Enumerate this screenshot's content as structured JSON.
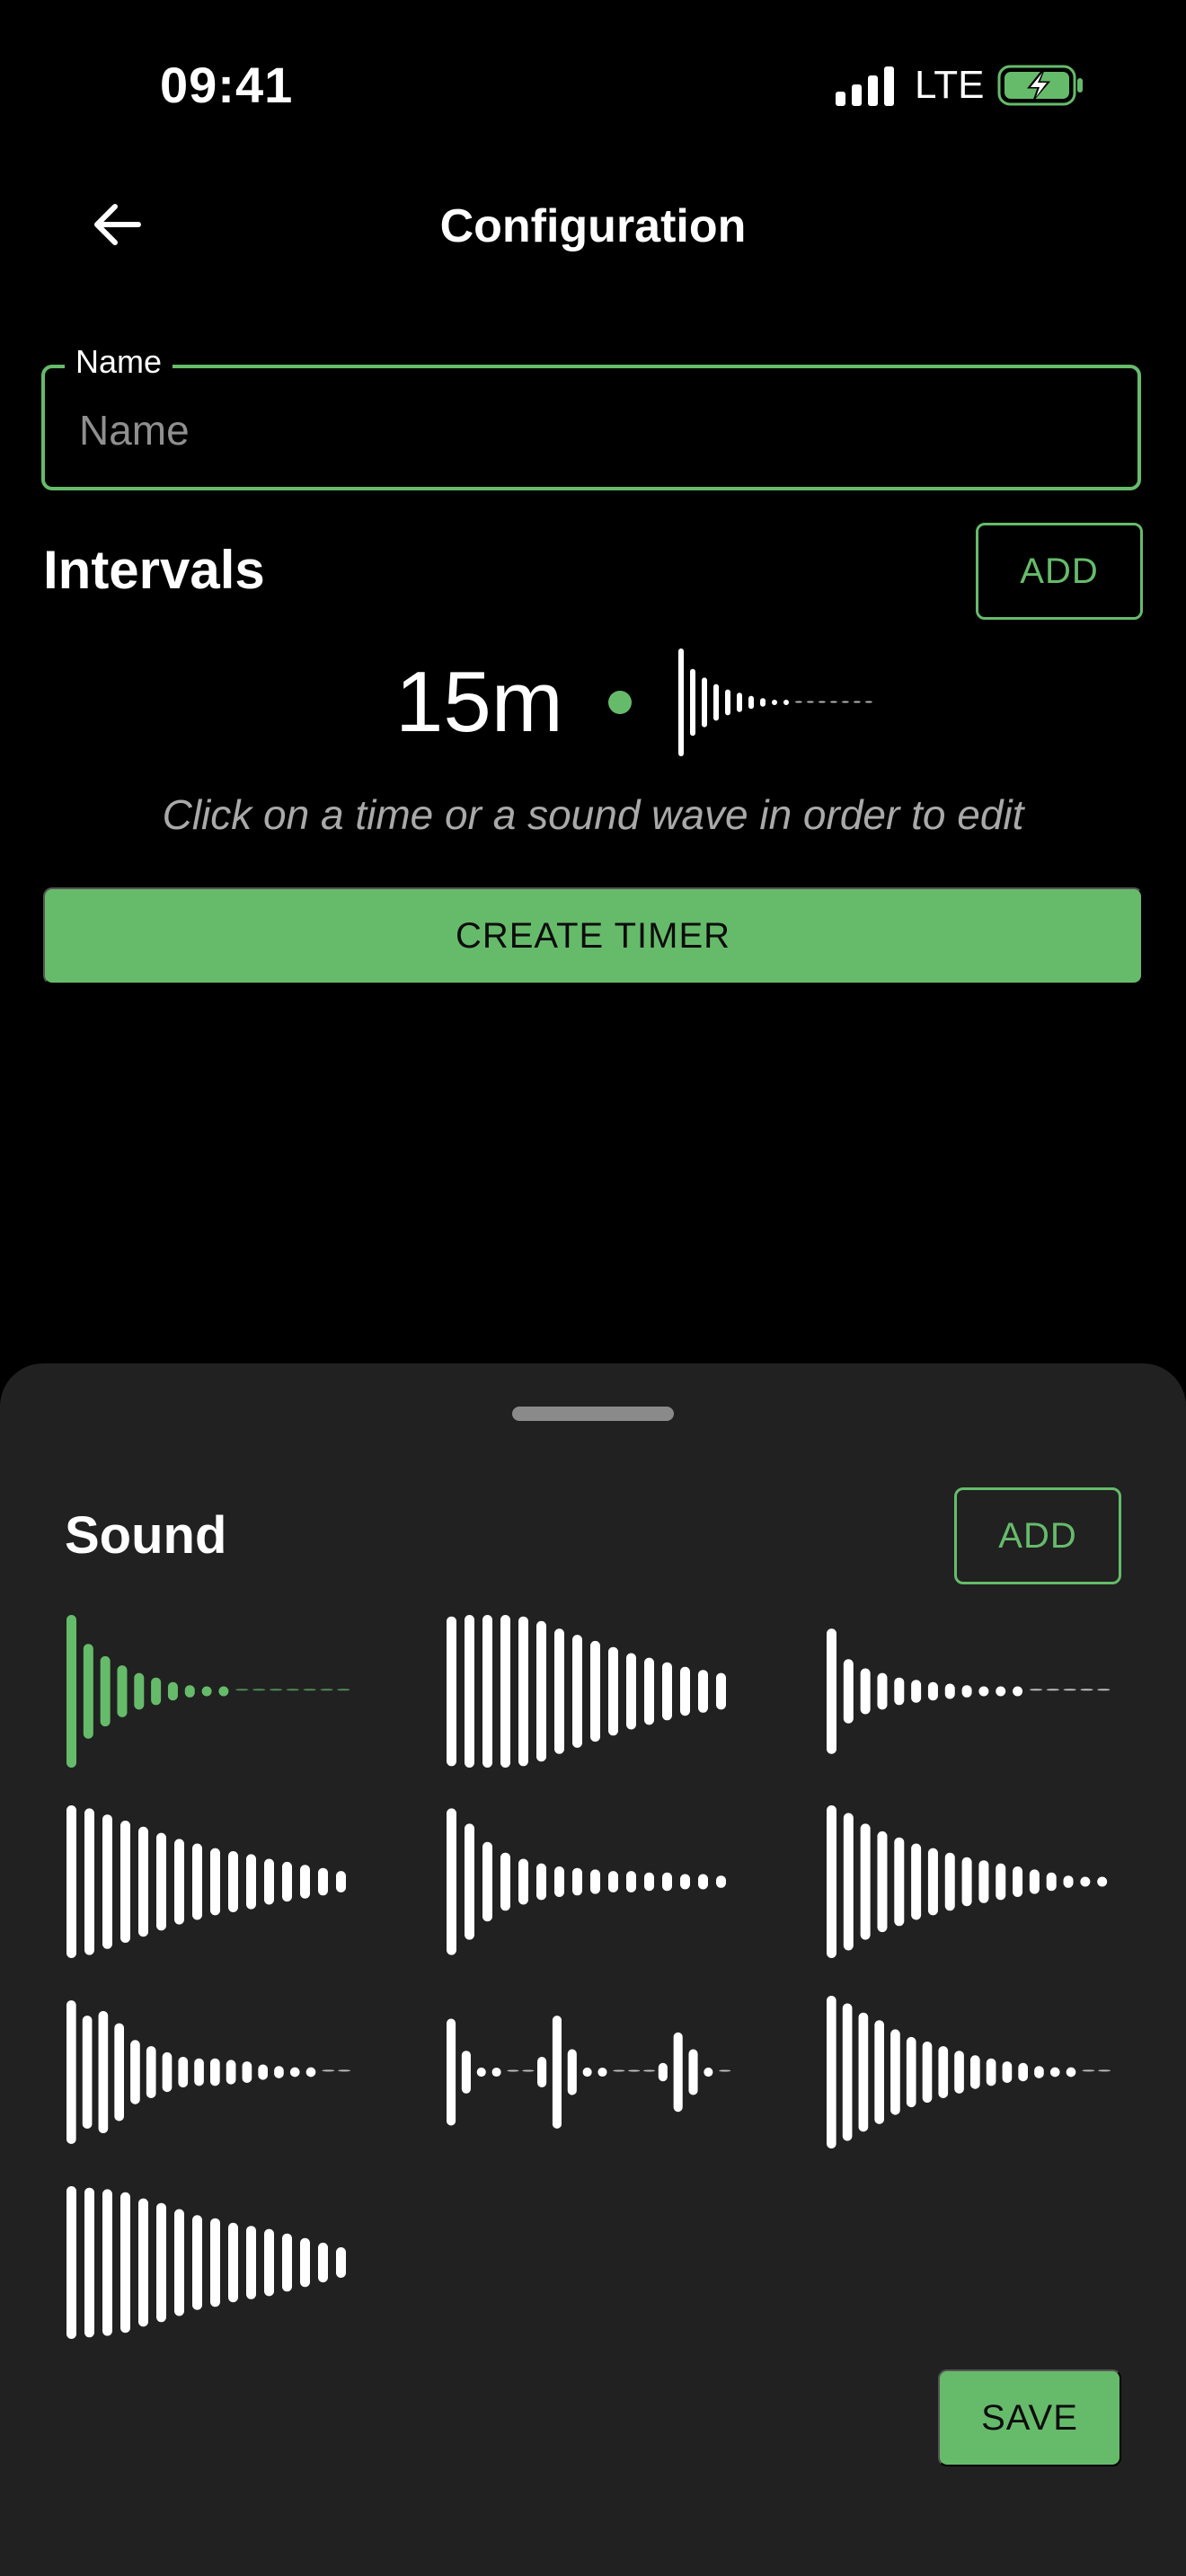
{
  "status_bar": {
    "time": "09:41",
    "network": "LTE"
  },
  "header": {
    "title": "Configuration"
  },
  "name_field": {
    "label": "Name",
    "placeholder": "Name",
    "value": ""
  },
  "intervals": {
    "title": "Intervals",
    "add_label": "ADD",
    "items": [
      {
        "time": "15m"
      }
    ],
    "hint": "Click on a time or a sound wave in order to edit"
  },
  "create_button": "CREATE TIMER",
  "sound_sheet": {
    "title": "Sound",
    "add_label": "ADD",
    "save_label": "SAVE",
    "selected_index": 0
  },
  "colors": {
    "accent": "#66bb6a",
    "background": "#000000",
    "sheet": "#212121"
  }
}
